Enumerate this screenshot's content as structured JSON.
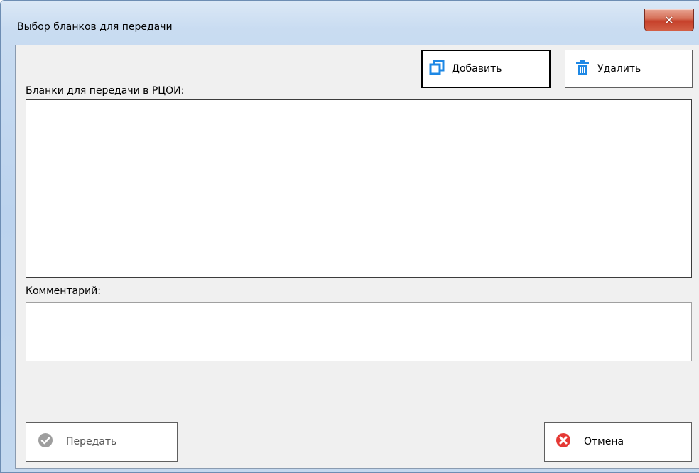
{
  "window": {
    "title": "Выбор бланков для передачи",
    "close_icon": "close-icon"
  },
  "toolbar": {
    "add_label": "Добавить",
    "add_icon": "copy-icon",
    "delete_label": "Удалить",
    "delete_icon": "trash-icon"
  },
  "form": {
    "blanks_label": "Бланки для передачи в РЦОИ:",
    "blanks_items": [],
    "comment_label": "Комментарий:",
    "comment_value": ""
  },
  "footer": {
    "send_label": "Передать",
    "send_icon": "check-circle-icon",
    "send_enabled": false,
    "cancel_label": "Отмена",
    "cancel_icon": "cancel-circle-icon"
  },
  "colors": {
    "accent_blue": "#1e88e5",
    "cancel_red": "#e53935",
    "disabled_gray": "#9e9e9e"
  }
}
